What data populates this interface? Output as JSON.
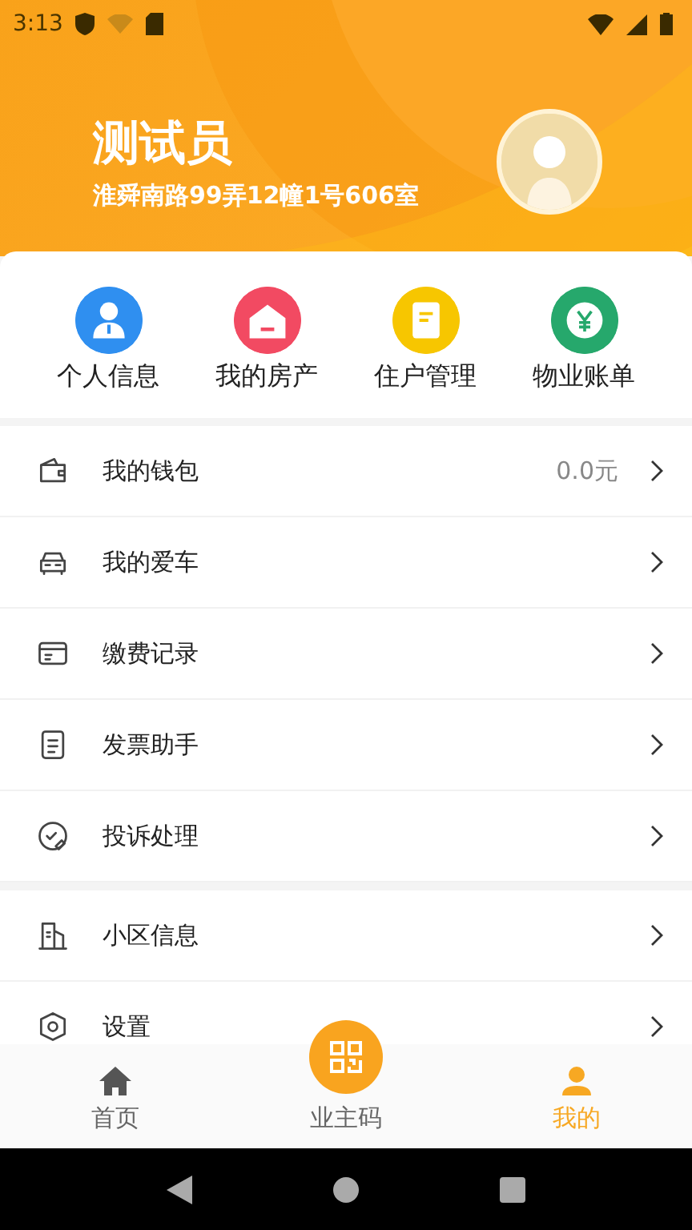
{
  "status_bar": {
    "time": "3:13"
  },
  "profile": {
    "name": "测试员",
    "address": "淮舜南路99弄12幢1号606室"
  },
  "shortcuts": [
    {
      "label": "个人信息",
      "kind": "person",
      "color": "#2f8ff0"
    },
    {
      "label": "我的房产",
      "kind": "house",
      "color": "#f24a62"
    },
    {
      "label": "住户管理",
      "kind": "clipboard",
      "color": "#f7c600"
    },
    {
      "label": "物业账单",
      "kind": "bill",
      "color": "#26a86c"
    }
  ],
  "menu_groups": [
    [
      {
        "label": "我的钱包",
        "kind": "wallet",
        "value": "0.0元"
      },
      {
        "label": "我的爱车",
        "kind": "car"
      },
      {
        "label": "缴费记录",
        "kind": "card"
      },
      {
        "label": "发票助手",
        "kind": "invoice"
      },
      {
        "label": "投诉处理",
        "kind": "complaint"
      }
    ],
    [
      {
        "label": "小区信息",
        "kind": "building"
      },
      {
        "label": "设置",
        "kind": "settings"
      }
    ]
  ],
  "tab_bar": [
    {
      "label": "首页",
      "kind": "home",
      "selected": false
    },
    {
      "label": "业主码",
      "kind": "qr",
      "selected": false
    },
    {
      "label": "我的",
      "kind": "me",
      "selected": true
    }
  ]
}
